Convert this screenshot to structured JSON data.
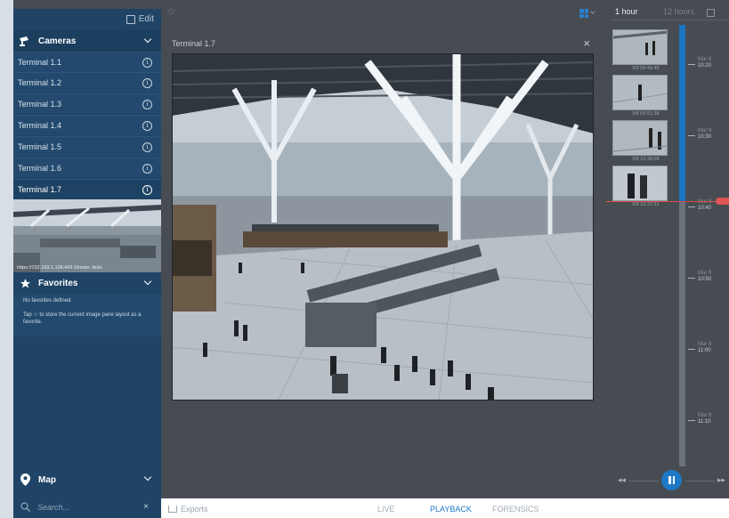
{
  "sidebar": {
    "edit_label": "Edit",
    "cameras_header": "Cameras",
    "cameras": [
      {
        "label": "Terminal 1.1"
      },
      {
        "label": "Terminal 1.2"
      },
      {
        "label": "Terminal 1.3"
      },
      {
        "label": "Terminal 1.4"
      },
      {
        "label": "Terminal 1.5"
      },
      {
        "label": "Terminal 1.6"
      },
      {
        "label": "Terminal 1.7"
      }
    ],
    "preview_url": "https://192.168.1.106:443 Stream: Auto",
    "favorites_header": "Favorites",
    "favorites_empty": "No favorites defined.",
    "favorites_hint_pre": "Tap",
    "favorites_hint_post": "to store the current image pane layout as a favorite.",
    "map_header": "Map",
    "search_placeholder": "Search..."
  },
  "viewer": {
    "title": "Terminal 1.7"
  },
  "timeline": {
    "range_1h": "1 hour",
    "range_12h": "12 hours",
    "thumbnails": [
      {
        "timestamp": "3/8 09:49:45"
      },
      {
        "timestamp": "3/8 09:51:38"
      },
      {
        "timestamp": "3/8 10:34:05"
      },
      {
        "timestamp": "3/8 10:37:21"
      }
    ],
    "ticks": [
      {
        "date": "Mar 8",
        "time": "10:20"
      },
      {
        "date": "Mar 8",
        "time": "10:30"
      },
      {
        "date": "Mar 8",
        "time": "10:40"
      },
      {
        "date": "Mar 8",
        "time": "10:50"
      },
      {
        "date": "Mar 8",
        "time": "11:00"
      },
      {
        "date": "Mar 8",
        "time": "11:10"
      }
    ],
    "accent_color": "#1d78c6",
    "now_color": "#d94747"
  },
  "bottom": {
    "exports_label": "Exports",
    "tabs": [
      {
        "label": "LIVE"
      },
      {
        "label": "PLAYBACK"
      },
      {
        "label": "FORENSICS"
      }
    ],
    "active_tab": "PLAYBACK"
  },
  "icons": [
    "edit-icon",
    "camera-icon",
    "info-icon",
    "star-icon",
    "map-pin-icon",
    "search-icon",
    "layout-grid-icon",
    "export-icon",
    "pause-icon",
    "rewind-icon",
    "fast-forward-icon",
    "close-icon"
  ]
}
